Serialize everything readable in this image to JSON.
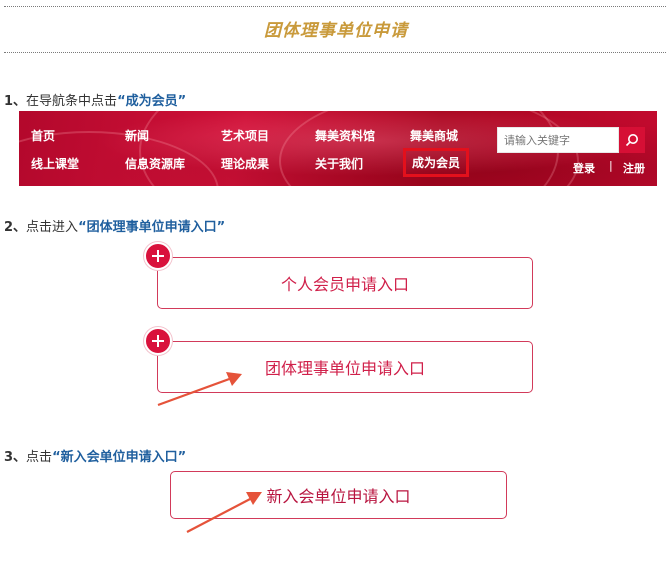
{
  "title": "团体理事单位申请",
  "steps": {
    "s1": {
      "num": "1、",
      "text": "在导航条中点击",
      "highlight": "“成为会员”"
    },
    "s2": {
      "num": "2、",
      "text": "点击进入",
      "highlight": "“团体理事单位申请入口”"
    },
    "s3": {
      "num": "3、",
      "text": "点击",
      "highlight": "“新入会单位申请入口”"
    }
  },
  "nav": {
    "row1": [
      "首页",
      "新闻",
      "艺术项目",
      "舞美资料馆",
      "舞美商城"
    ],
    "row2": [
      "线上课堂",
      "信息资源库",
      "理论成果",
      "关于我们",
      "成为会员"
    ],
    "search_placeholder": "请输入关键字",
    "login": "登录",
    "divider": "|",
    "register": "注册"
  },
  "cards": {
    "personal": "个人会员申请入口",
    "group": "团体理事单位申请入口",
    "new_member": "新入会单位申请入口"
  },
  "colors": {
    "title": "#c99a3b",
    "highlight": "#1f5f9e",
    "brand_red": "#d9123c",
    "arrow": "#e5533a"
  },
  "icons": {
    "search": "search-icon",
    "plus": "plus-icon",
    "arrow": "arrow-icon"
  }
}
